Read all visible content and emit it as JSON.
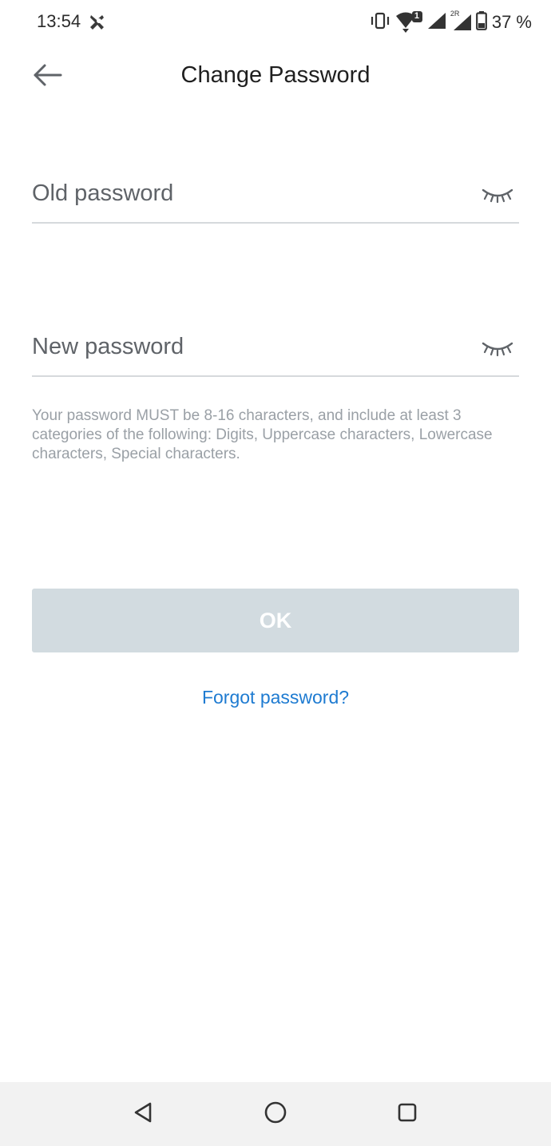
{
  "status_bar": {
    "time": "13:54",
    "battery": "37 %",
    "icons": [
      "app-notification-icon",
      "vibrate-icon",
      "wifi-icon",
      "sim1-signal-icon",
      "sim2-signal-icon",
      "battery-icon"
    ],
    "wifi_badge": "1",
    "sim2_label": "2R"
  },
  "header": {
    "back_icon": "arrow-left-icon",
    "title": "Change Password"
  },
  "form": {
    "old_password": {
      "placeholder": "Old password",
      "value": "",
      "toggle_icon": "eye-closed-icon"
    },
    "new_password": {
      "placeholder": "New password",
      "value": "",
      "toggle_icon": "eye-closed-icon"
    },
    "hint": "Your password MUST be 8-16 characters, and include at least 3 categories of the following: Digits, Uppercase characters, Lowercase characters, Special characters.",
    "ok_label": "OK",
    "ok_enabled": false,
    "forgot_label": "Forgot password?"
  },
  "colors": {
    "link": "#1e7bd1",
    "button_disabled": "#d2dbe0",
    "hint_text": "#9aa0a6"
  },
  "nav_bar": {
    "icons": [
      "nav-back-icon",
      "nav-home-icon",
      "nav-recents-icon"
    ]
  }
}
